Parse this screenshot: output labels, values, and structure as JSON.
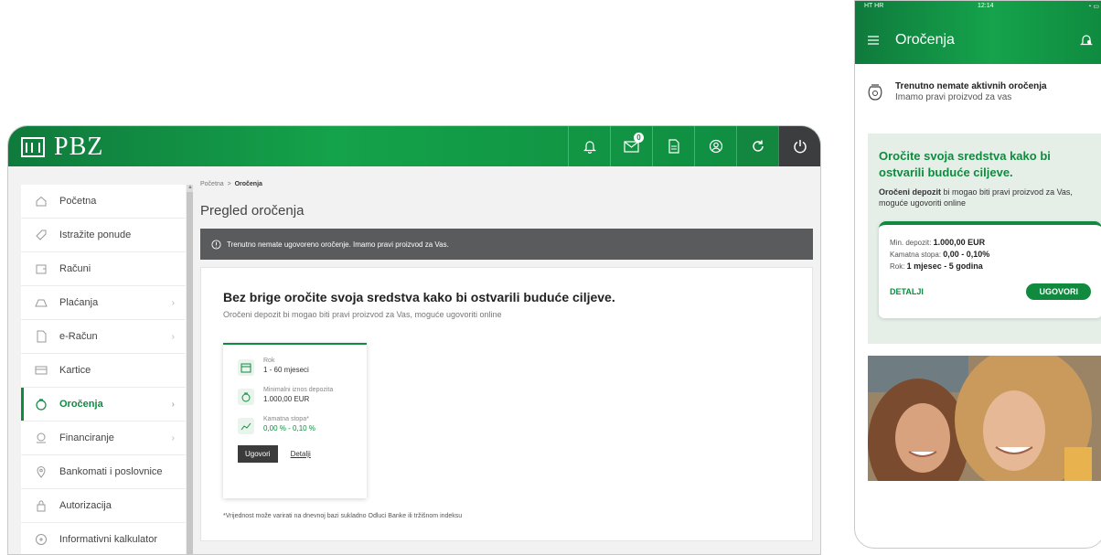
{
  "desktop": {
    "logo_text": "PBZ",
    "top_icons": [
      "bell-icon",
      "mail-icon",
      "document-icon",
      "user-circle-icon",
      "refresh-icon",
      "power-icon"
    ],
    "sidebar": {
      "items": [
        {
          "label": "Početna",
          "icon": "home-icon",
          "chevron": false,
          "active": false
        },
        {
          "label": "Istražite ponude",
          "icon": "tag-icon",
          "chevron": false,
          "active": false
        },
        {
          "label": "Računi",
          "icon": "wallet-icon",
          "chevron": false,
          "active": false
        },
        {
          "label": "Plaćanja",
          "icon": "payment-icon",
          "chevron": true,
          "active": false
        },
        {
          "label": "e-Račun",
          "icon": "ebill-icon",
          "chevron": true,
          "active": false
        },
        {
          "label": "Kartice",
          "icon": "card-icon",
          "chevron": false,
          "active": false
        },
        {
          "label": "Oročenja",
          "icon": "deposit-icon",
          "chevron": true,
          "active": true
        },
        {
          "label": "Financiranje",
          "icon": "finance-icon",
          "chevron": true,
          "active": false
        },
        {
          "label": "Bankomati i poslovnice",
          "icon": "location-icon",
          "chevron": false,
          "active": false
        },
        {
          "label": "Autorizacija",
          "icon": "lock-icon",
          "chevron": false,
          "active": false
        },
        {
          "label": "Informativni kalkulator",
          "icon": "calculator-icon",
          "chevron": false,
          "active": false
        }
      ]
    },
    "breadcrumb": {
      "home": "Početna",
      "separator": ">",
      "current": "Oročenja"
    },
    "page_title": "Pregled oročenja",
    "alert_text": "Trenutno nemate ugovoreno oročenje. Imamo pravi proizvod za Vas.",
    "card": {
      "headline": "Bez brige oročite svoja sredstva kako bi ostvarili buduće ciljeve.",
      "subtitle": "Oročeni depozit bi mogao biti pravi proizvod za Vas, moguće ugovoriti online",
      "rok_label": "Rok",
      "rok_value": "1 - 60 mjeseci",
      "min_label": "Minimalni iznos depozita",
      "min_value": "1.000,00 EUR",
      "rate_label": "Kamatna stopa*",
      "rate_value": "0,00 % - 0,10 %",
      "primary_button": "Ugovori",
      "details_link": "Detalji",
      "footnote": "*Vrijednost može varirati na dnevnoj bazi sukladno Odluci Banke ili tržišnom indeksu"
    }
  },
  "mobile": {
    "status": {
      "carrier": "HT HR",
      "time": "12:14"
    },
    "title": "Oročenja",
    "empty_title": "Trenutno nemate aktivnih oročenja",
    "empty_sub": "Imamo pravi proizvod za vas",
    "promo": {
      "title": "Oročite svoja sredstva kako bi ostvarili buduće ciljeve.",
      "bold_lead": "Oročeni depozit",
      "text": " bi mogao biti pravi proizvod za Vas, moguće ugovoriti online",
      "min_label": "Min. depozit: ",
      "min_value": "1.000,00 EUR",
      "rate_label": "Kamatna stopa: ",
      "rate_value": "0,00 - 0,10%",
      "term_label": "Rok: ",
      "term_value": "1 mjesec - 5 godina",
      "details_link": "DETALJI",
      "primary_button": "UGOVORI"
    }
  },
  "colors": {
    "brand_green": "#118a40",
    "dark_gray": "#5a5b5c",
    "promo_bg": "#e5efe8"
  }
}
